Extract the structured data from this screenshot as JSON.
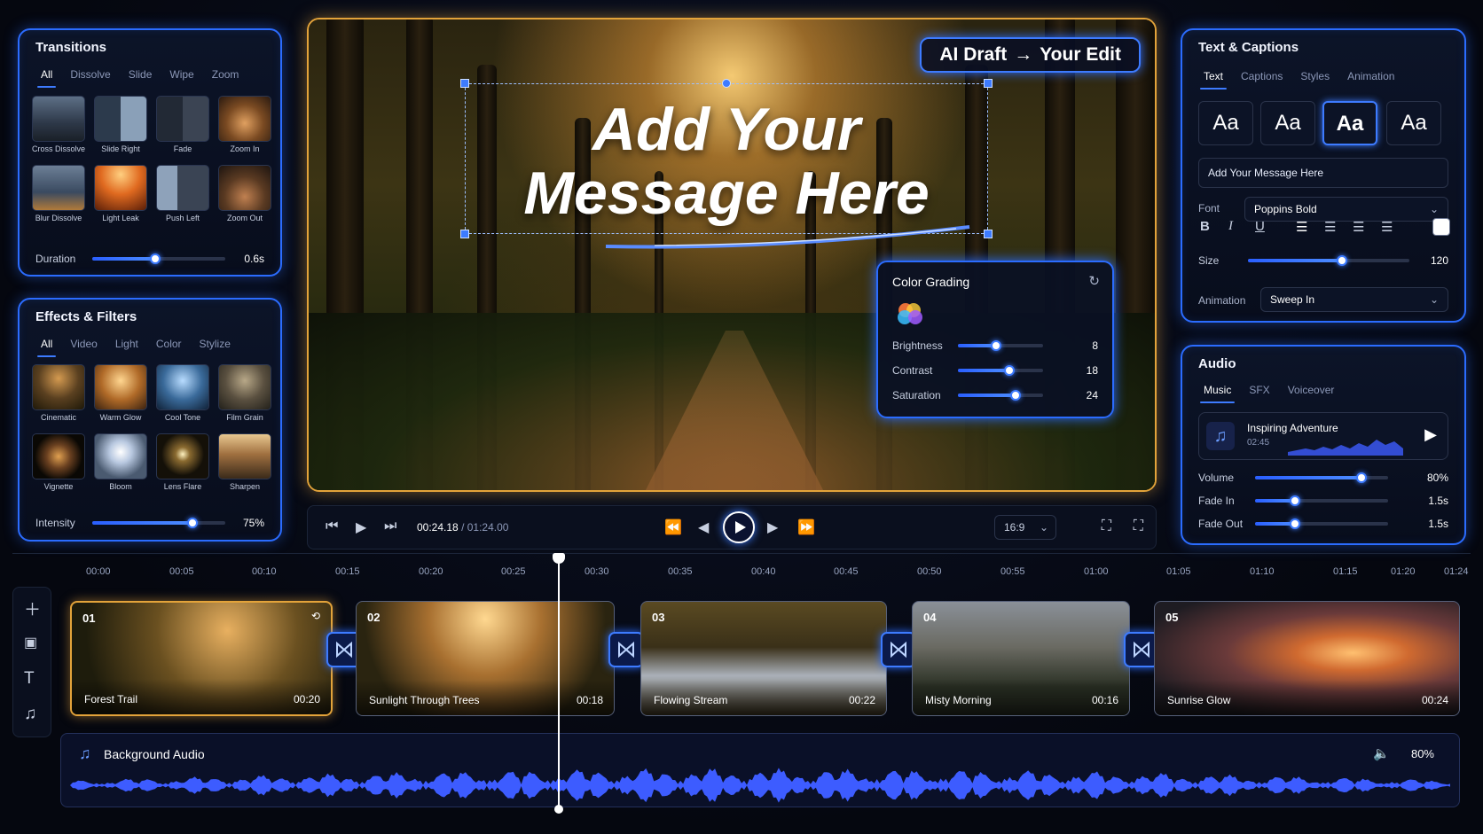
{
  "transitions": {
    "title": "Transitions",
    "tabs": [
      "All",
      "Dissolve",
      "Slide",
      "Wipe",
      "Zoom"
    ],
    "items": [
      "Cross Dissolve",
      "Slide Right",
      "Fade",
      "Zoom In",
      "Blur Dissolve",
      "Light Leak",
      "Push Left",
      "Zoom Out"
    ],
    "duration_label": "Duration",
    "duration_value": "0.6s",
    "duration_fraction": 0.47
  },
  "effects": {
    "title": "Effects & Filters",
    "tabs": [
      "All",
      "Video",
      "Light",
      "Color",
      "Stylize"
    ],
    "items": [
      "Cinematic",
      "Warm Glow",
      "Cool Tone",
      "Film Grain",
      "Vignette",
      "Bloom",
      "Lens Flare",
      "Sharpen"
    ],
    "intensity_label": "Intensity",
    "intensity_value": "75%",
    "intensity_fraction": 0.75
  },
  "preview": {
    "badge_left": "AI Draft",
    "badge_arrow": "→",
    "badge_right": "Your Edit",
    "headline_line1": "Add Your",
    "headline_line2": "Message Here"
  },
  "color_grading": {
    "title": "Color Grading",
    "rows": [
      {
        "label": "Brightness",
        "value": "8",
        "fraction": 0.45
      },
      {
        "label": "Contrast",
        "value": "18",
        "fraction": 0.6
      },
      {
        "label": "Saturation",
        "value": "24",
        "fraction": 0.68
      }
    ]
  },
  "transport": {
    "current_time": "00:24.18",
    "separator": "/",
    "total_time": "01:24.00",
    "aspect": "16:9"
  },
  "text_captions": {
    "title": "Text & Captions",
    "tabs": [
      "Text",
      "Captions",
      "Styles",
      "Animation"
    ],
    "style_samples": [
      "Aa",
      "Aa",
      "Aa",
      "Aa"
    ],
    "selected_style_index": 2,
    "text_value": "Add Your Message Here",
    "font_label": "Font",
    "font_value": "Poppins Bold",
    "size_label": "Size",
    "size_value": "120",
    "size_fraction": 0.58,
    "animation_label": "Animation",
    "animation_value": "Sweep In",
    "text_color": "#ffffff"
  },
  "audio": {
    "title": "Audio",
    "tabs": [
      "Music",
      "SFX",
      "Voiceover"
    ],
    "track_name": "Inspiring Adventure",
    "track_time": "02:45",
    "rows": [
      {
        "label": "Volume",
        "value": "80%",
        "fraction": 0.8
      },
      {
        "label": "Fade In",
        "value": "1.5s",
        "fraction": 0.3
      },
      {
        "label": "Fade Out",
        "value": "1.5s",
        "fraction": 0.3
      }
    ]
  },
  "timeline": {
    "ticks": [
      "00:00",
      "00:05",
      "00:10",
      "00:15",
      "00:20",
      "00:25",
      "00:30",
      "00:35",
      "00:40",
      "00:45",
      "00:50",
      "00:55",
      "01:00",
      "01:05",
      "01:10",
      "01:15",
      "01:20",
      "01:24"
    ],
    "clips": [
      {
        "num": "01",
        "name": "Forest Trail",
        "duration": "00:20"
      },
      {
        "num": "02",
        "name": "Sunlight Through Trees",
        "duration": "00:18"
      },
      {
        "num": "03",
        "name": "Flowing Stream",
        "duration": "00:22"
      },
      {
        "num": "04",
        "name": "Misty Morning",
        "duration": "00:16"
      },
      {
        "num": "05",
        "name": "Sunrise Glow",
        "duration": "00:24"
      }
    ],
    "audio_track_name": "Background Audio",
    "audio_volume": "80%"
  },
  "colors": {
    "accent": "#3d7bff",
    "selection": "#e3a33a",
    "background": "#05070f"
  }
}
